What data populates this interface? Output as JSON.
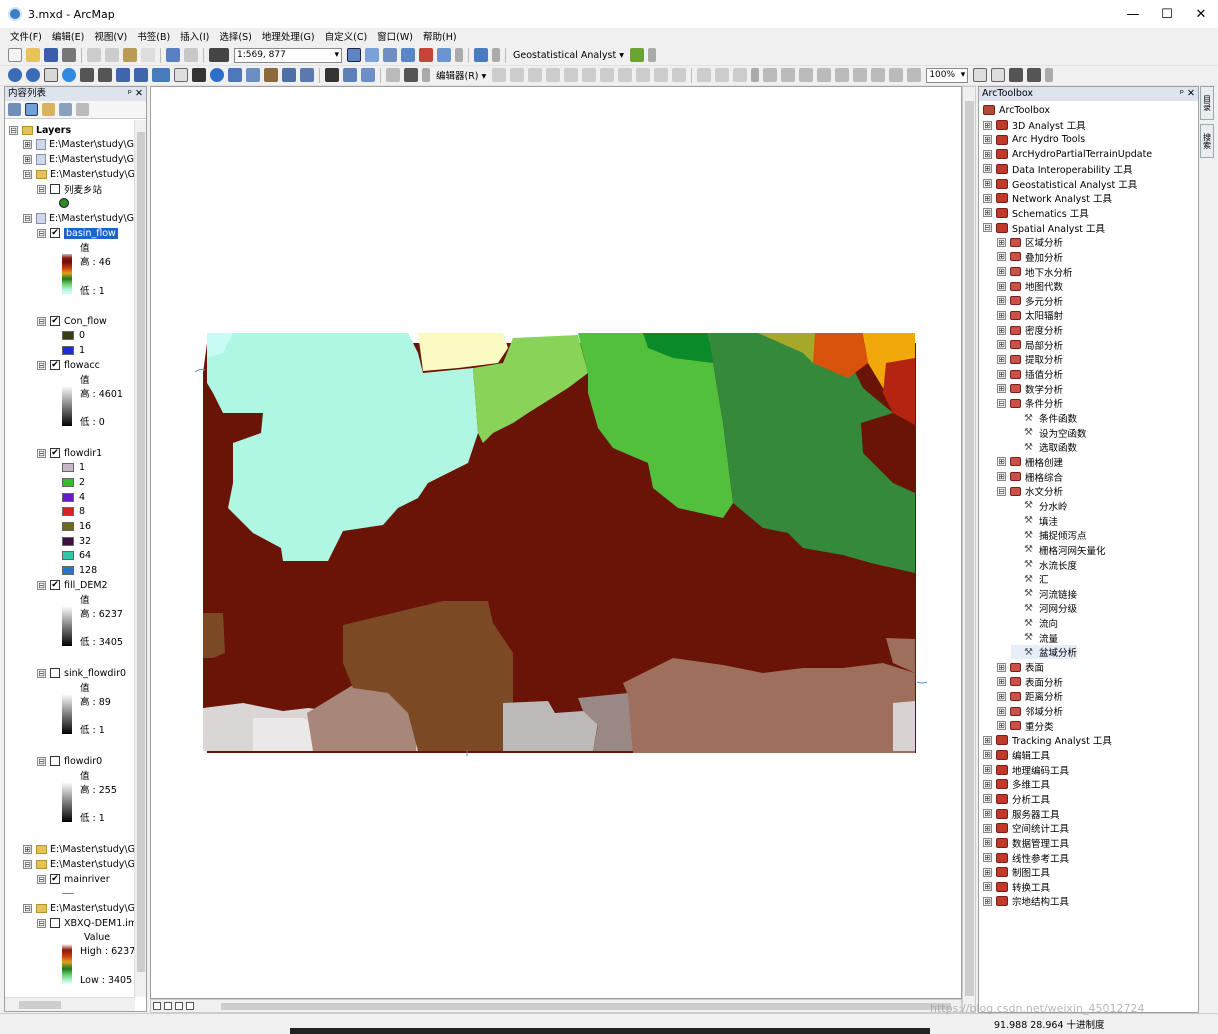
{
  "window": {
    "title": "3.mxd - ArcMap",
    "minimize": "—",
    "maximize": "☐",
    "close": "✕"
  },
  "menu": [
    "文件(F)",
    "编辑(E)",
    "视图(V)",
    "书签(B)",
    "插入(I)",
    "选择(S)",
    "地理处理(G)",
    "自定义(C)",
    "窗口(W)",
    "帮助(H)"
  ],
  "toolbar": {
    "scale": "1:569, 877",
    "geostat": "Geostatistical Analyst ▾",
    "editor": "编辑器(R) ▾",
    "zoom_pct": "100%"
  },
  "toc": {
    "title": "内容列表",
    "pin": "ᵖ",
    "close": "✕",
    "layers_label": "Layers",
    "items": [
      {
        "kind": "lyr",
        "label": "E:\\Master\\study\\GI",
        "exp": "⊞"
      },
      {
        "kind": "lyr",
        "label": "E:\\Master\\study\\GI",
        "exp": "⊞"
      },
      {
        "kind": "folder",
        "label": "E:\\Master\\study\\GI",
        "exp": "⊟"
      },
      {
        "kind": "layer",
        "label": "列麦乡站",
        "checked": false,
        "indent": 1
      },
      {
        "kind": "lyr",
        "label": "E:\\Master\\study\\GI",
        "exp": "⊟"
      },
      {
        "kind": "layer",
        "label": "basin_flow",
        "checked": true,
        "indent": 1,
        "selected": true
      }
    ],
    "basin_flow": {
      "value": "值",
      "high": "高 : 46",
      "low": "低 : 1"
    },
    "con_flow": {
      "label": "Con_flow",
      "classes": [
        {
          "label": "0",
          "color": "#3b3b12"
        },
        {
          "label": "1",
          "color": "#1f2bd8"
        }
      ]
    },
    "flowacc": {
      "label": "flowacc",
      "value": "值",
      "high": "高 : 4601",
      "low": "低 : 0"
    },
    "flowdir1": {
      "label": "flowdir1",
      "classes": [
        {
          "label": "1",
          "color": "#c5b7c5"
        },
        {
          "label": "2",
          "color": "#2fbd2f"
        },
        {
          "label": "4",
          "color": "#6a19c9"
        },
        {
          "label": "8",
          "color": "#d9221c"
        },
        {
          "label": "16",
          "color": "#6c6c10"
        },
        {
          "label": "32",
          "color": "#3f1040"
        },
        {
          "label": "64",
          "color": "#2ec7a7"
        },
        {
          "label": "128",
          "color": "#2b73c7"
        }
      ]
    },
    "fill_dem2": {
      "label": "fill_DEM2",
      "value": "值",
      "high": "高 : 6237",
      "low": "低 : 3405"
    },
    "sink_flowdir0": {
      "label": "sink_flowdir0",
      "value": "值",
      "high": "高 : 89",
      "low": "低 : 1"
    },
    "flowdir0": {
      "label": "flowdir0",
      "value": "值",
      "high": "高 : 255",
      "low": "低 : 1"
    },
    "folder1": "E:\\Master\\study\\GI",
    "folder2": "E:\\Master\\study\\GI",
    "mainriver": "mainriver",
    "folder3": "E:\\Master\\study\\GI",
    "xbxq": {
      "label": "XBXQ-DEM1.im",
      "value": "Value",
      "high": "High : 6237",
      "low": "Low : 3405"
    }
  },
  "arctoolbox": {
    "title": "ArcToolbox",
    "pin": "ᵖ",
    "close": "✕",
    "root": "ArcToolbox",
    "items": [
      {
        "label": "3D Analyst 工具",
        "level": 0,
        "exp": "⊞"
      },
      {
        "label": "Arc Hydro Tools",
        "level": 0,
        "exp": "⊞"
      },
      {
        "label": "ArcHydroPartialTerrainUpdate",
        "level": 0,
        "exp": "⊞"
      },
      {
        "label": "Data Interoperability 工具",
        "level": 0,
        "exp": "⊞"
      },
      {
        "label": "Geostatistical Analyst 工具",
        "level": 0,
        "exp": "⊞"
      },
      {
        "label": "Network Analyst 工具",
        "level": 0,
        "exp": "⊞"
      },
      {
        "label": "Schematics 工具",
        "level": 0,
        "exp": "⊞"
      },
      {
        "label": "Spatial Analyst 工具",
        "level": 0,
        "exp": "⊟"
      },
      {
        "label": "区域分析",
        "level": 1,
        "exp": "⊞"
      },
      {
        "label": "叠加分析",
        "level": 1,
        "exp": "⊞"
      },
      {
        "label": "地下水分析",
        "level": 1,
        "exp": "⊞"
      },
      {
        "label": "地图代数",
        "level": 1,
        "exp": "⊞"
      },
      {
        "label": "多元分析",
        "level": 1,
        "exp": "⊞"
      },
      {
        "label": "太阳辐射",
        "level": 1,
        "exp": "⊞"
      },
      {
        "label": "密度分析",
        "level": 1,
        "exp": "⊞"
      },
      {
        "label": "局部分析",
        "level": 1,
        "exp": "⊞"
      },
      {
        "label": "提取分析",
        "level": 1,
        "exp": "⊞"
      },
      {
        "label": "插值分析",
        "level": 1,
        "exp": "⊞"
      },
      {
        "label": "数学分析",
        "level": 1,
        "exp": "⊞"
      },
      {
        "label": "条件分析",
        "level": 1,
        "exp": "⊟"
      },
      {
        "label": "条件函数",
        "level": 2,
        "tool": true
      },
      {
        "label": "设为空函数",
        "level": 2,
        "tool": true
      },
      {
        "label": "选取函数",
        "level": 2,
        "tool": true
      },
      {
        "label": "栅格创建",
        "level": 1,
        "exp": "⊞"
      },
      {
        "label": "栅格综合",
        "level": 1,
        "exp": "⊞"
      },
      {
        "label": "水文分析",
        "level": 1,
        "exp": "⊟"
      },
      {
        "label": "分水岭",
        "level": 2,
        "tool": true
      },
      {
        "label": "填洼",
        "level": 2,
        "tool": true
      },
      {
        "label": "捕捉倾泻点",
        "level": 2,
        "tool": true
      },
      {
        "label": "栅格河网矢量化",
        "level": 2,
        "tool": true
      },
      {
        "label": "水流长度",
        "level": 2,
        "tool": true
      },
      {
        "label": "汇",
        "level": 2,
        "tool": true
      },
      {
        "label": "河流链接",
        "level": 2,
        "tool": true
      },
      {
        "label": "河网分级",
        "level": 2,
        "tool": true
      },
      {
        "label": "流向",
        "level": 2,
        "tool": true
      },
      {
        "label": "流量",
        "level": 2,
        "tool": true
      },
      {
        "label": "盆域分析",
        "level": 2,
        "tool": true,
        "selected": true
      },
      {
        "label": "表面",
        "level": 1,
        "exp": "⊞"
      },
      {
        "label": "表面分析",
        "level": 1,
        "exp": "⊞"
      },
      {
        "label": "距离分析",
        "level": 1,
        "exp": "⊞"
      },
      {
        "label": "邻域分析",
        "level": 1,
        "exp": "⊞"
      },
      {
        "label": "重分类",
        "level": 1,
        "exp": "⊞"
      },
      {
        "label": "Tracking Analyst 工具",
        "level": 0,
        "exp": "⊞"
      },
      {
        "label": "编辑工具",
        "level": 0,
        "exp": "⊞"
      },
      {
        "label": "地理编码工具",
        "level": 0,
        "exp": "⊞"
      },
      {
        "label": "多维工具",
        "level": 0,
        "exp": "⊞"
      },
      {
        "label": "分析工具",
        "level": 0,
        "exp": "⊞"
      },
      {
        "label": "服务器工具",
        "level": 0,
        "exp": "⊞"
      },
      {
        "label": "空间统计工具",
        "level": 0,
        "exp": "⊞"
      },
      {
        "label": "数据管理工具",
        "level": 0,
        "exp": "⊞"
      },
      {
        "label": "线性参考工具",
        "level": 0,
        "exp": "⊞"
      },
      {
        "label": "制图工具",
        "level": 0,
        "exp": "⊞"
      },
      {
        "label": "转换工具",
        "level": 0,
        "exp": "⊞"
      },
      {
        "label": "宗地结构工具",
        "level": 0,
        "exp": "⊞"
      }
    ]
  },
  "side_tabs": [
    "目录",
    "搜索"
  ],
  "status": {
    "coords": "91.988  28.964 十进制度",
    "watermark": "https://blog.csdn.net/weixin_45012724"
  }
}
